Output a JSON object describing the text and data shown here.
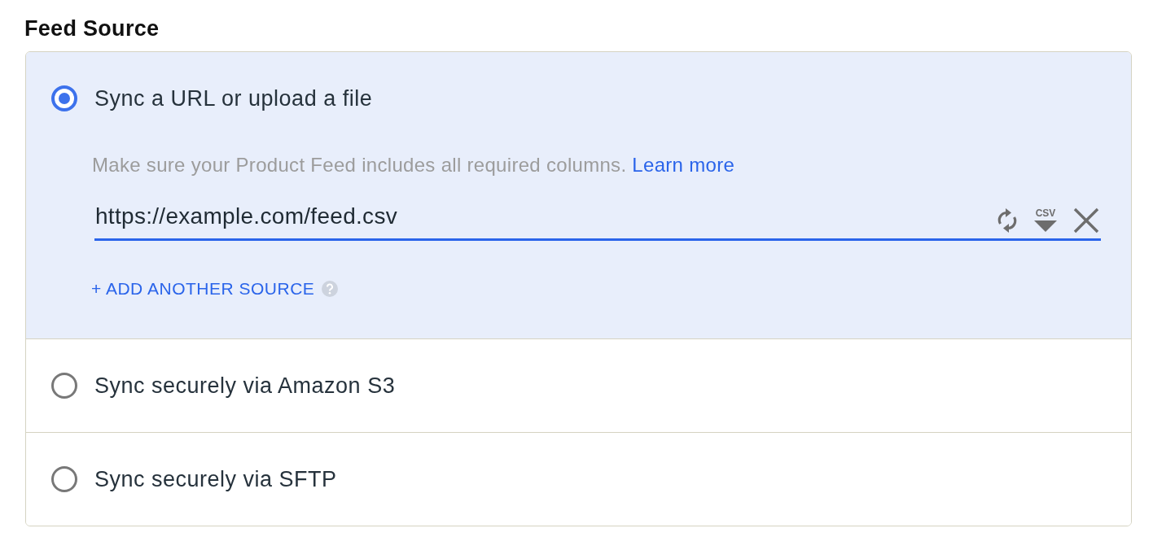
{
  "title": "Feed Source",
  "options": [
    {
      "label": "Sync a URL or upload a file",
      "selected": true,
      "details": {
        "help_text": "Make sure your Product Feed includes all required columns.",
        "help_link": "Learn more",
        "url_field": {
          "value": "https://example.com/feed.csv",
          "focused": true
        },
        "format_button": "CSV",
        "add_source": "+ ADD ANOTHER SOURCE"
      }
    },
    {
      "label": "Sync securely via Amazon S3",
      "selected": false
    },
    {
      "label": "Sync securely via SFTP",
      "selected": false
    }
  ]
}
